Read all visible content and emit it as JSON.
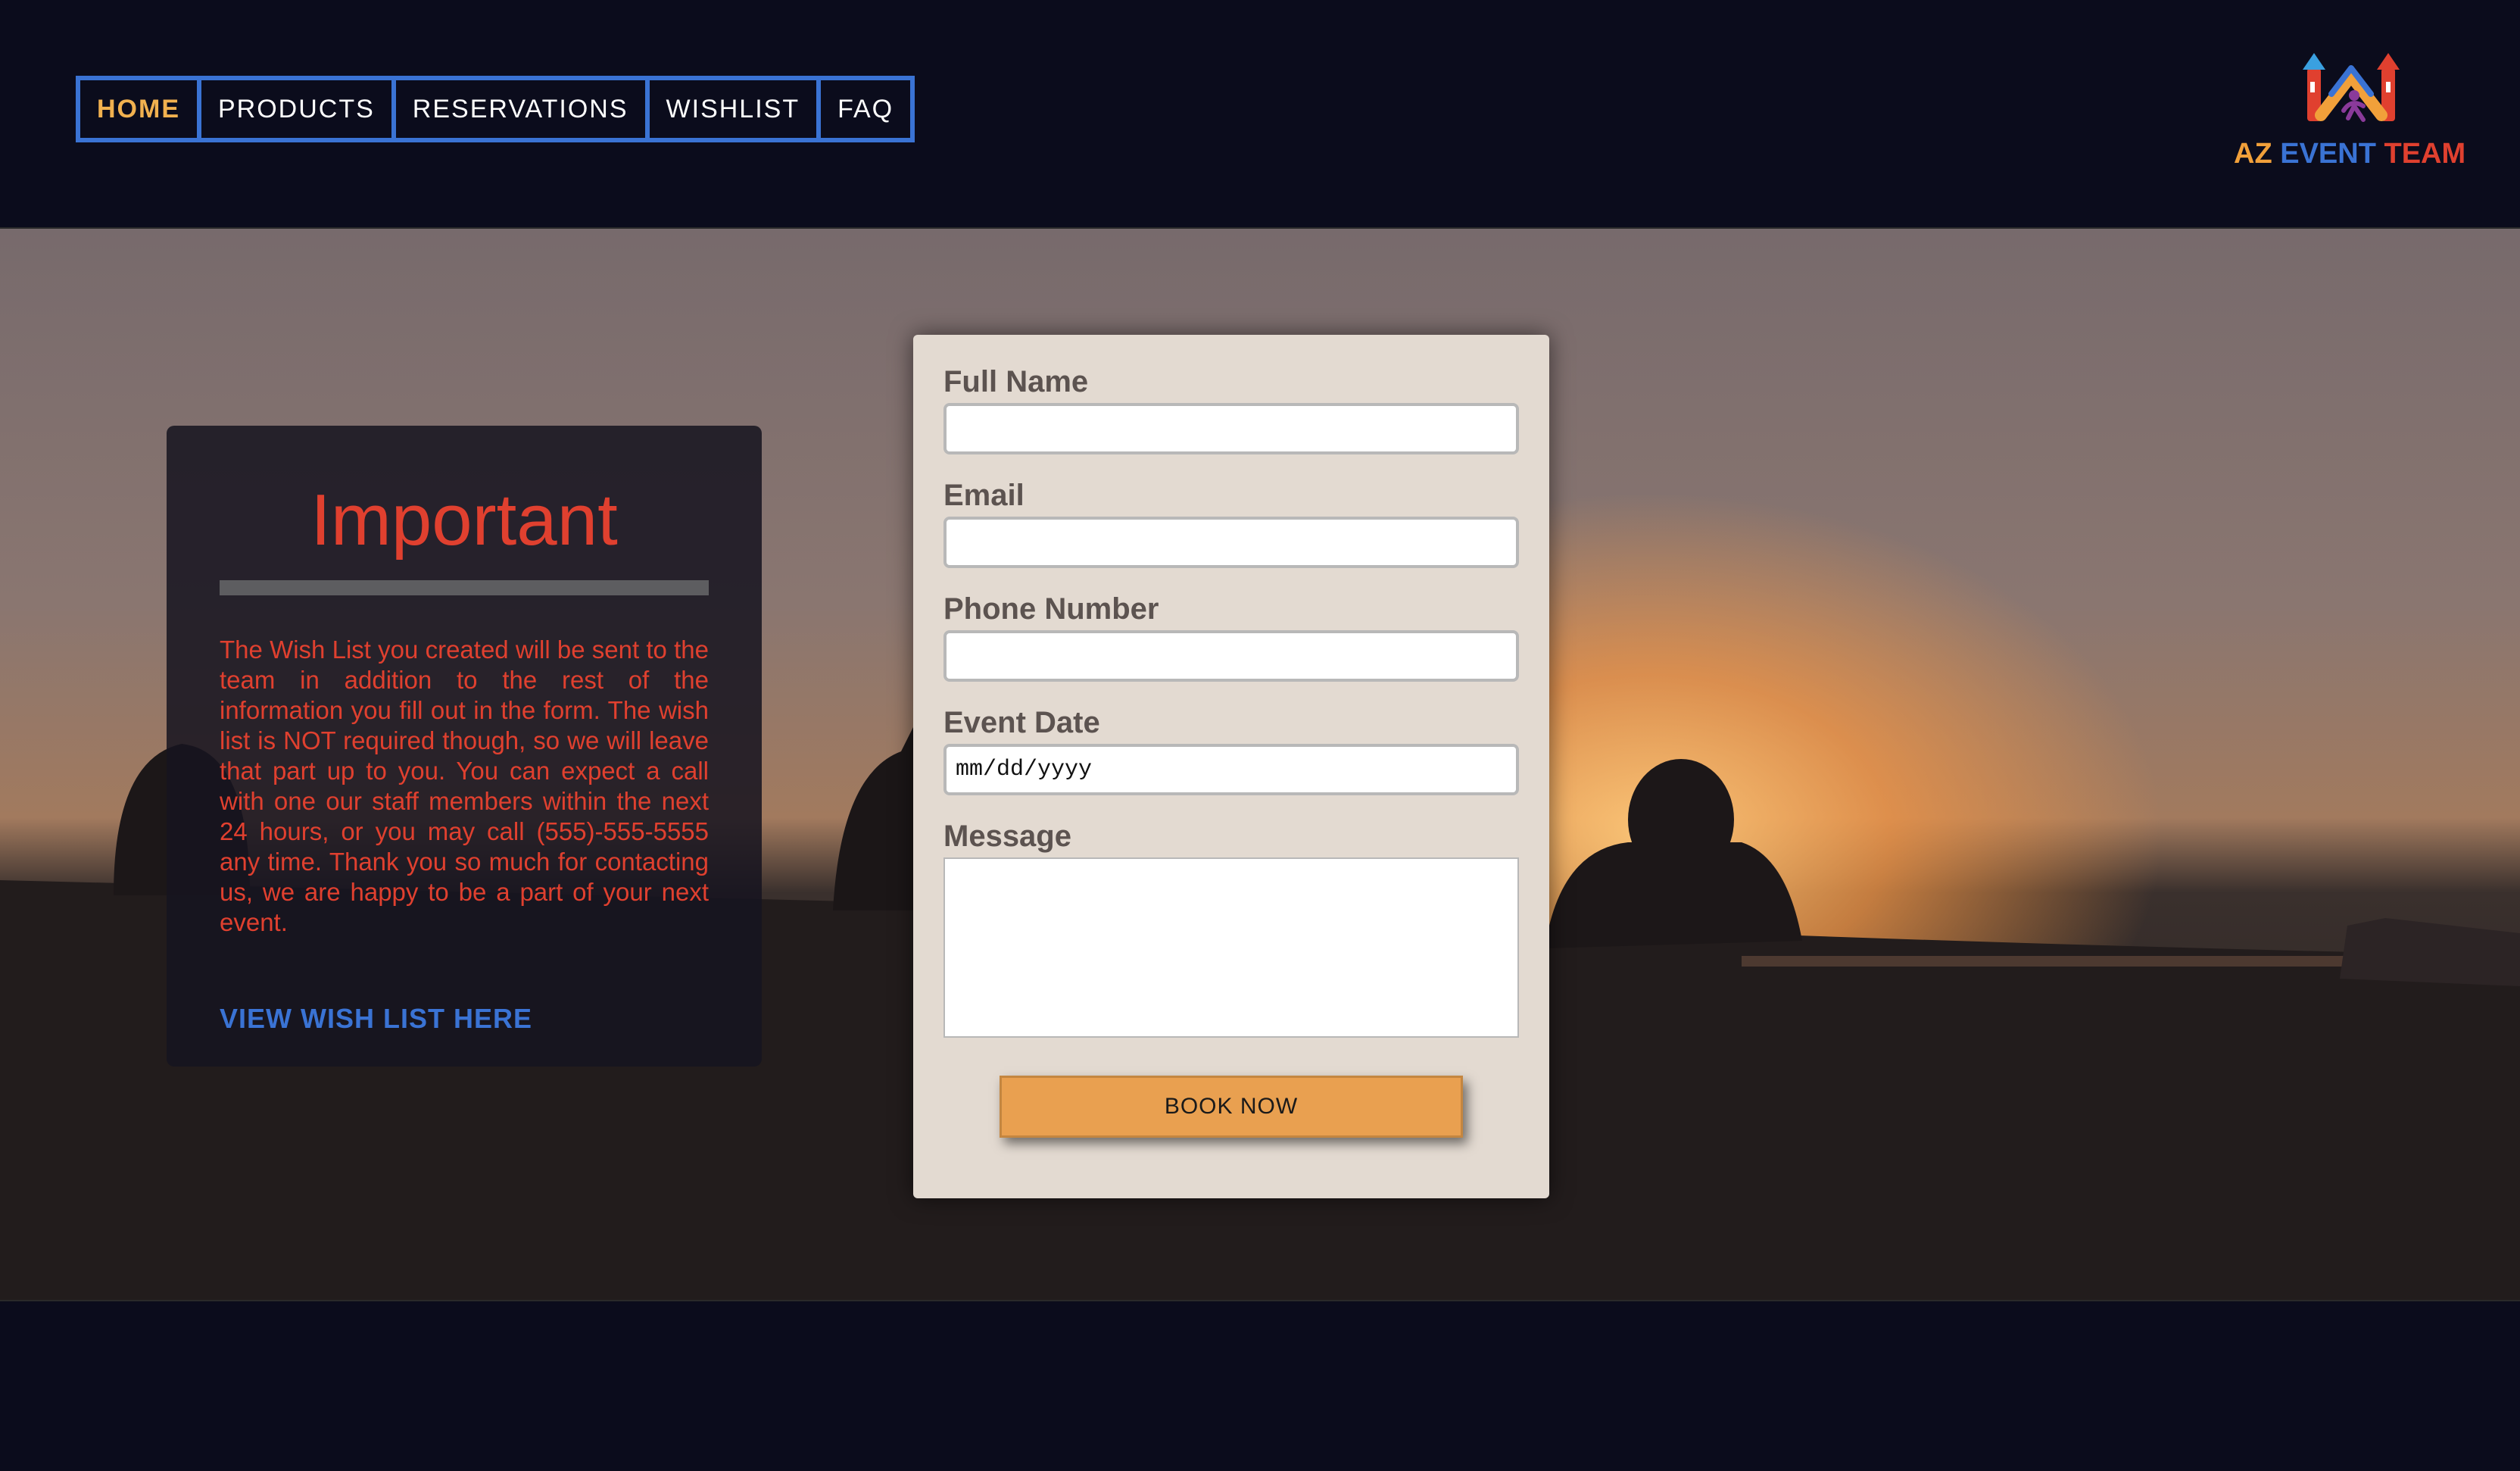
{
  "nav": {
    "items": [
      {
        "label": "HOME",
        "active": true
      },
      {
        "label": "PRODUCTS"
      },
      {
        "label": "RESERVATIONS"
      },
      {
        "label": "WISHLIST"
      },
      {
        "label": "FAQ"
      }
    ]
  },
  "logo": {
    "part1": "AZ",
    "part2": "EVENT",
    "part3": "TEAM"
  },
  "notice": {
    "title": "Important",
    "body": "The Wish List you created will be sent to the team in addition to the rest of the information you fill out in the form. The wish list is NOT required though, so we will leave that part up to you. You can expect a call with one our staff members within the next 24 hours, or you may call (555)-555-5555 any time. Thank you so much for contacting us, we are happy to be a part of your next event.",
    "link": "VIEW WISH LIST HERE"
  },
  "form": {
    "full_name_label": "Full Name",
    "email_label": "Email",
    "phone_label": "Phone Number",
    "date_label": "Event Date",
    "date_placeholder": "mm/dd/yyyy",
    "message_label": "Message",
    "submit_label": "BOOK NOW"
  },
  "colors": {
    "accent_blue": "#3a73d4",
    "accent_orange": "#f1b14f",
    "alert_red": "#e0402f",
    "button_orange": "#e9a050",
    "background": "#0b0c1c"
  }
}
